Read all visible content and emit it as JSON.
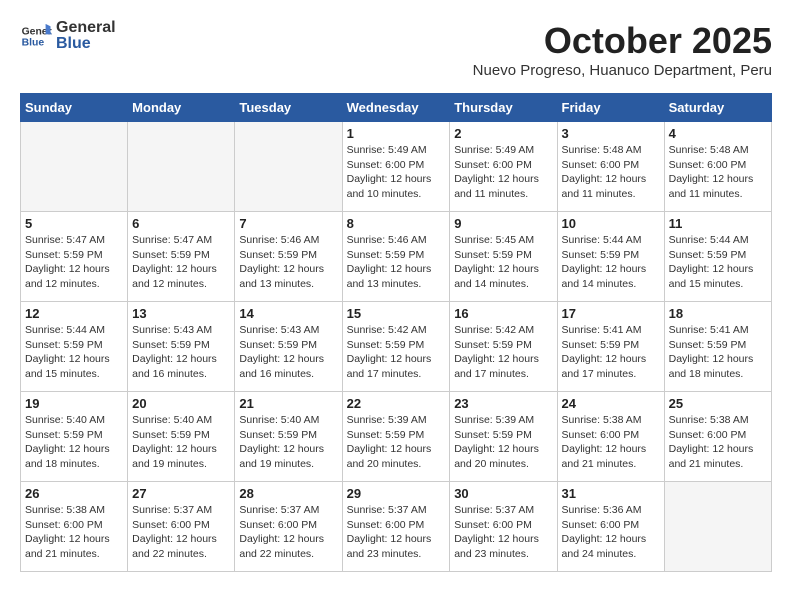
{
  "header": {
    "logo_general": "General",
    "logo_blue": "Blue",
    "month_title": "October 2025",
    "subtitle": "Nuevo Progreso, Huanuco Department, Peru"
  },
  "weekdays": [
    "Sunday",
    "Monday",
    "Tuesday",
    "Wednesday",
    "Thursday",
    "Friday",
    "Saturday"
  ],
  "weeks": [
    [
      {
        "day": "",
        "info": ""
      },
      {
        "day": "",
        "info": ""
      },
      {
        "day": "",
        "info": ""
      },
      {
        "day": "1",
        "info": "Sunrise: 5:49 AM\nSunset: 6:00 PM\nDaylight: 12 hours\nand 10 minutes."
      },
      {
        "day": "2",
        "info": "Sunrise: 5:49 AM\nSunset: 6:00 PM\nDaylight: 12 hours\nand 11 minutes."
      },
      {
        "day": "3",
        "info": "Sunrise: 5:48 AM\nSunset: 6:00 PM\nDaylight: 12 hours\nand 11 minutes."
      },
      {
        "day": "4",
        "info": "Sunrise: 5:48 AM\nSunset: 6:00 PM\nDaylight: 12 hours\nand 11 minutes."
      }
    ],
    [
      {
        "day": "5",
        "info": "Sunrise: 5:47 AM\nSunset: 5:59 PM\nDaylight: 12 hours\nand 12 minutes."
      },
      {
        "day": "6",
        "info": "Sunrise: 5:47 AM\nSunset: 5:59 PM\nDaylight: 12 hours\nand 12 minutes."
      },
      {
        "day": "7",
        "info": "Sunrise: 5:46 AM\nSunset: 5:59 PM\nDaylight: 12 hours\nand 13 minutes."
      },
      {
        "day": "8",
        "info": "Sunrise: 5:46 AM\nSunset: 5:59 PM\nDaylight: 12 hours\nand 13 minutes."
      },
      {
        "day": "9",
        "info": "Sunrise: 5:45 AM\nSunset: 5:59 PM\nDaylight: 12 hours\nand 14 minutes."
      },
      {
        "day": "10",
        "info": "Sunrise: 5:44 AM\nSunset: 5:59 PM\nDaylight: 12 hours\nand 14 minutes."
      },
      {
        "day": "11",
        "info": "Sunrise: 5:44 AM\nSunset: 5:59 PM\nDaylight: 12 hours\nand 15 minutes."
      }
    ],
    [
      {
        "day": "12",
        "info": "Sunrise: 5:44 AM\nSunset: 5:59 PM\nDaylight: 12 hours\nand 15 minutes."
      },
      {
        "day": "13",
        "info": "Sunrise: 5:43 AM\nSunset: 5:59 PM\nDaylight: 12 hours\nand 16 minutes."
      },
      {
        "day": "14",
        "info": "Sunrise: 5:43 AM\nSunset: 5:59 PM\nDaylight: 12 hours\nand 16 minutes."
      },
      {
        "day": "15",
        "info": "Sunrise: 5:42 AM\nSunset: 5:59 PM\nDaylight: 12 hours\nand 17 minutes."
      },
      {
        "day": "16",
        "info": "Sunrise: 5:42 AM\nSunset: 5:59 PM\nDaylight: 12 hours\nand 17 minutes."
      },
      {
        "day": "17",
        "info": "Sunrise: 5:41 AM\nSunset: 5:59 PM\nDaylight: 12 hours\nand 17 minutes."
      },
      {
        "day": "18",
        "info": "Sunrise: 5:41 AM\nSunset: 5:59 PM\nDaylight: 12 hours\nand 18 minutes."
      }
    ],
    [
      {
        "day": "19",
        "info": "Sunrise: 5:40 AM\nSunset: 5:59 PM\nDaylight: 12 hours\nand 18 minutes."
      },
      {
        "day": "20",
        "info": "Sunrise: 5:40 AM\nSunset: 5:59 PM\nDaylight: 12 hours\nand 19 minutes."
      },
      {
        "day": "21",
        "info": "Sunrise: 5:40 AM\nSunset: 5:59 PM\nDaylight: 12 hours\nand 19 minutes."
      },
      {
        "day": "22",
        "info": "Sunrise: 5:39 AM\nSunset: 5:59 PM\nDaylight: 12 hours\nand 20 minutes."
      },
      {
        "day": "23",
        "info": "Sunrise: 5:39 AM\nSunset: 5:59 PM\nDaylight: 12 hours\nand 20 minutes."
      },
      {
        "day": "24",
        "info": "Sunrise: 5:38 AM\nSunset: 6:00 PM\nDaylight: 12 hours\nand 21 minutes."
      },
      {
        "day": "25",
        "info": "Sunrise: 5:38 AM\nSunset: 6:00 PM\nDaylight: 12 hours\nand 21 minutes."
      }
    ],
    [
      {
        "day": "26",
        "info": "Sunrise: 5:38 AM\nSunset: 6:00 PM\nDaylight: 12 hours\nand 21 minutes."
      },
      {
        "day": "27",
        "info": "Sunrise: 5:37 AM\nSunset: 6:00 PM\nDaylight: 12 hours\nand 22 minutes."
      },
      {
        "day": "28",
        "info": "Sunrise: 5:37 AM\nSunset: 6:00 PM\nDaylight: 12 hours\nand 22 minutes."
      },
      {
        "day": "29",
        "info": "Sunrise: 5:37 AM\nSunset: 6:00 PM\nDaylight: 12 hours\nand 23 minutes."
      },
      {
        "day": "30",
        "info": "Sunrise: 5:37 AM\nSunset: 6:00 PM\nDaylight: 12 hours\nand 23 minutes."
      },
      {
        "day": "31",
        "info": "Sunrise: 5:36 AM\nSunset: 6:00 PM\nDaylight: 12 hours\nand 24 minutes."
      },
      {
        "day": "",
        "info": ""
      }
    ]
  ]
}
